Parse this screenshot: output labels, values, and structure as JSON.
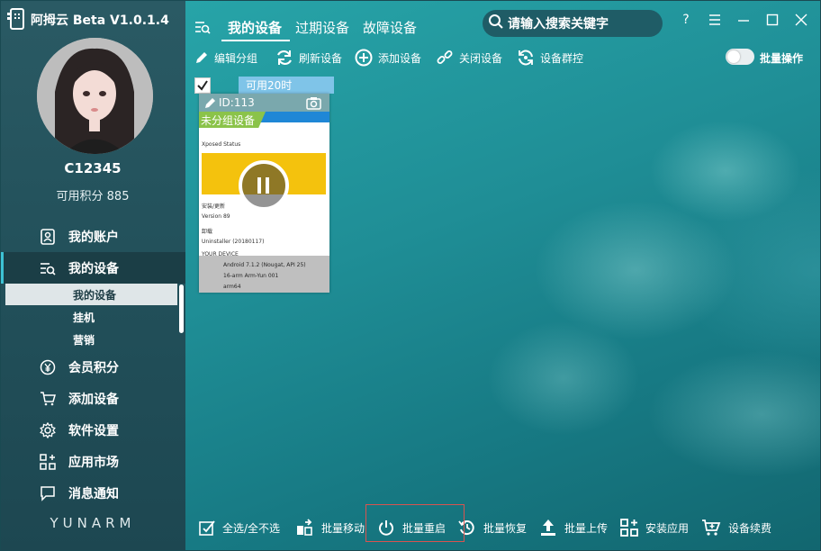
{
  "app": {
    "title": "阿拇云 Beta V1.0.1.4",
    "brand_footer": "YUNARM"
  },
  "user": {
    "name": "C12345",
    "points": "可用积分 885"
  },
  "sidebar": {
    "items": [
      {
        "label": "我的账户",
        "icon": "user-card-icon"
      },
      {
        "label": "我的设备",
        "icon": "device-list-icon"
      },
      {
        "label": "会员积分",
        "icon": "yen-icon"
      },
      {
        "label": "添加设备",
        "icon": "cart-icon"
      },
      {
        "label": "软件设置",
        "icon": "gear-icon"
      },
      {
        "label": "应用市场",
        "icon": "apps-icon"
      },
      {
        "label": "消息通知",
        "icon": "message-icon"
      }
    ],
    "sub_items": [
      {
        "label": "我的设备"
      },
      {
        "label": "挂机"
      },
      {
        "label": "营销"
      }
    ]
  },
  "tabs": [
    {
      "label": "我的设备"
    },
    {
      "label": "过期设备"
    },
    {
      "label": "故障设备"
    }
  ],
  "search": {
    "placeholder": "请输入搜索关键字"
  },
  "window_controls": {
    "help": "?"
  },
  "toolbar": {
    "items": [
      {
        "label": "编辑分组",
        "icon": "pencil-icon"
      },
      {
        "label": "刷新设备",
        "icon": "refresh-icon"
      },
      {
        "label": "添加设备",
        "icon": "plus-circle-icon"
      },
      {
        "label": "关闭设备",
        "icon": "link-icon"
      },
      {
        "label": "设备群控",
        "icon": "sync-icon"
      }
    ],
    "batch_label": "批量操作"
  },
  "device": {
    "time_left": "可用20时",
    "id": "ID:113",
    "group": "未分组设备",
    "screen_rows": [
      "Xposed Status",
      "安装/更新",
      "Version 89",
      "卸载",
      "Uninstaller (20180117)",
      "YOUR DEVICE",
      "Android 7.1.2 (Nougat, API 25)",
      "16-arm Arm-Yun 001",
      "arm64"
    ]
  },
  "bottombar": {
    "items": [
      {
        "label": "全选/全不选",
        "icon": "checkbox-icon"
      },
      {
        "label": "批量移动",
        "icon": "move-icon"
      },
      {
        "label": "批量重启",
        "icon": "power-icon"
      },
      {
        "label": "批量恢复",
        "icon": "restore-icon"
      },
      {
        "label": "批量上传",
        "icon": "upload-icon"
      },
      {
        "label": "安装应用",
        "icon": "install-icon"
      },
      {
        "label": "设备续费",
        "icon": "renew-cart-icon"
      }
    ]
  },
  "colors": {
    "accent": "#3dc2d4",
    "sidebar_bg": "#22505a",
    "badge_green": "#8bc34a",
    "badge_blue": "#7fc4e8"
  }
}
